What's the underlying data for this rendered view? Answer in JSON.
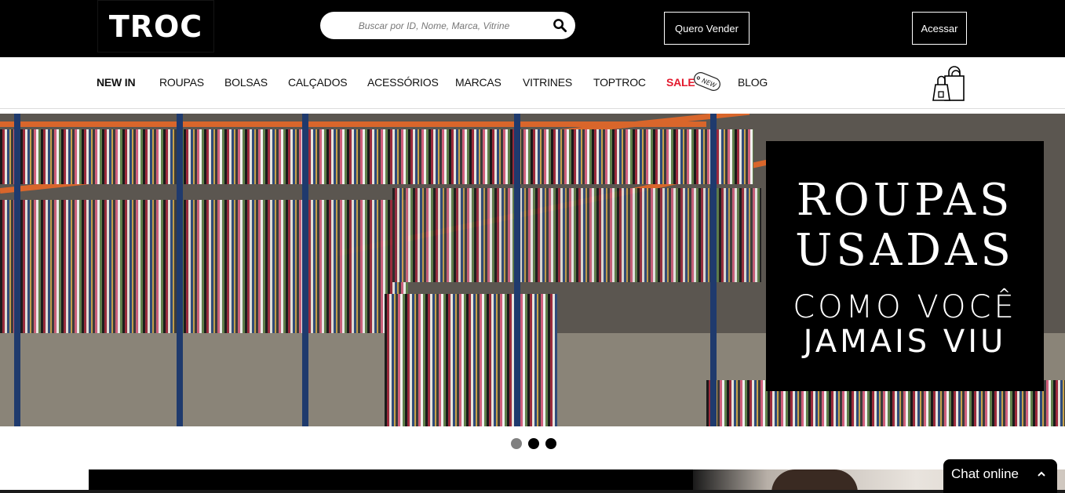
{
  "header": {
    "logo_text": "TROC",
    "search": {
      "placeholder": "Buscar por ID, Nome, Marca, Vitrine",
      "icon": "search-icon"
    },
    "sell_button": "Quero Vender",
    "login_button": "Acessar"
  },
  "nav": {
    "items": [
      {
        "label": "NEW IN",
        "active": true
      },
      {
        "label": "ROUPAS"
      },
      {
        "label": "BOLSAS"
      },
      {
        "label": "CALÇADOS"
      },
      {
        "label": "ACESSÓRIOS"
      },
      {
        "label": "MARCAS"
      },
      {
        "label": "VITRINES"
      },
      {
        "label": "TOPTROC"
      },
      {
        "label": "SALE",
        "color": "#e3192d"
      },
      {
        "label": "BLOG"
      }
    ],
    "badge_text": "NEW",
    "cart_icon": "shopping-bags-icon"
  },
  "hero": {
    "line1": "ROUPAS",
    "line2": "USADAS",
    "line3": "COMO VOCÊ",
    "line4": "JAMAIS VIU"
  },
  "carousel": {
    "slide_count": 3,
    "current_slide": 2
  },
  "chat": {
    "label": "Chat online",
    "icon": "chevron-up-icon"
  },
  "colors": {
    "header_bg": "#000000",
    "sale": "#e3192d",
    "dot_inactive": "#808080"
  }
}
